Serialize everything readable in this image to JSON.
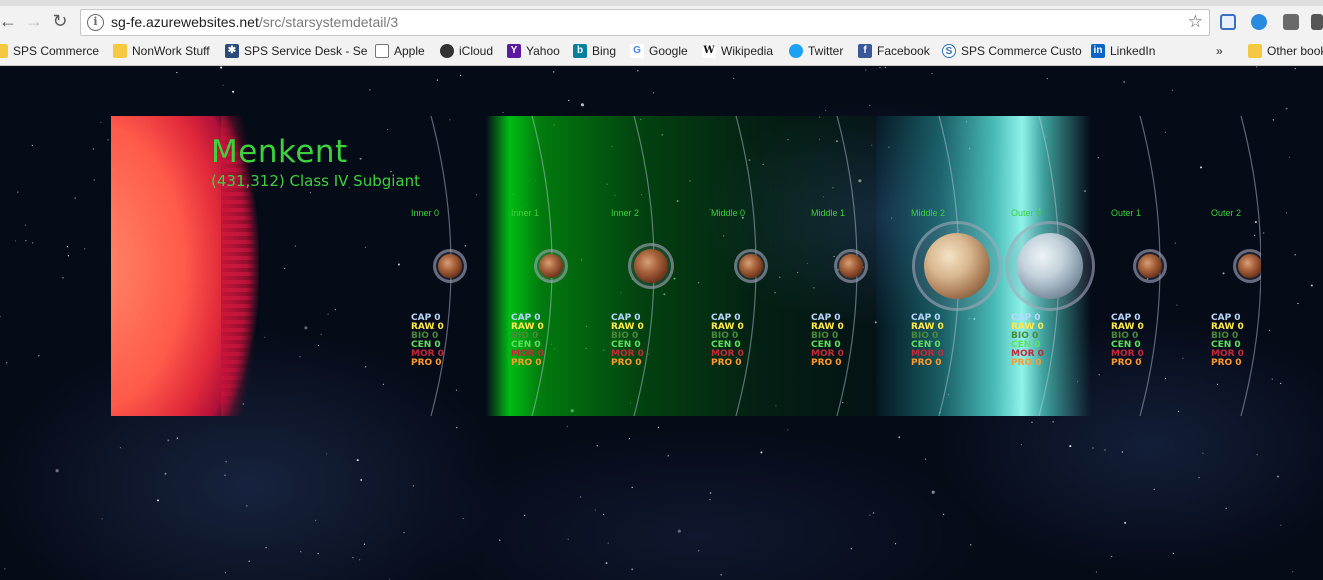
{
  "browser": {
    "url_host": "sg-fe.azurewebsites.net",
    "url_path": "/src/starsystemdetail/3",
    "bookmarks": [
      {
        "label": "SPS Commerce",
        "icon": "folder-icon"
      },
      {
        "label": "NonWork Stuff",
        "icon": "folder-icon"
      },
      {
        "label": "SPS Service Desk - Se",
        "icon": "service-desk-icon"
      },
      {
        "label": "Apple",
        "icon": "page-icon"
      },
      {
        "label": "iCloud",
        "icon": "apple-icon"
      },
      {
        "label": "Yahoo",
        "icon": "yahoo-icon"
      },
      {
        "label": "Bing",
        "icon": "bing-icon"
      },
      {
        "label": "Google",
        "icon": "google-icon"
      },
      {
        "label": "Wikipedia",
        "icon": "wikipedia-icon"
      },
      {
        "label": "Twitter",
        "icon": "twitter-icon"
      },
      {
        "label": "Facebook",
        "icon": "facebook-icon"
      },
      {
        "label": "SPS Commerce Custo",
        "icon": "sps-icon"
      },
      {
        "label": "LinkedIn",
        "icon": "linkedin-icon"
      }
    ],
    "overflow_label": "»",
    "other_bookmarks": "Other book"
  },
  "system": {
    "name": "Menkent",
    "info": "(431,312) Class IV Subgiant"
  },
  "slots": [
    {
      "label": "Inner 0",
      "planet": "rocky",
      "cap": "CAP 0",
      "raw": "RAW 0",
      "bio": "BIO 0",
      "cen": "CEN 0",
      "mor": "MOR 0",
      "pro": "PRO 0"
    },
    {
      "label": "Inner 1",
      "planet": "rocky",
      "cap": "CAP 0",
      "raw": "RAW 0",
      "bio": "BIO 0",
      "cen": "CEN 0",
      "mor": "MOR 0",
      "pro": "PRO 0"
    },
    {
      "label": "Inner 2",
      "planet": "rocky-large",
      "cap": "CAP 0",
      "raw": "RAW 0",
      "bio": "BIO 0",
      "cen": "CEN 0",
      "mor": "MOR 0",
      "pro": "PRO 0"
    },
    {
      "label": "Middle 0",
      "planet": "rocky",
      "cap": "CAP 0",
      "raw": "RAW 0",
      "bio": "BIO 0",
      "cen": "CEN 0",
      "mor": "MOR 0",
      "pro": "PRO 0"
    },
    {
      "label": "Middle 1",
      "planet": "rocky",
      "cap": "CAP 0",
      "raw": "RAW 0",
      "bio": "BIO 0",
      "cen": "CEN 0",
      "mor": "MOR 0",
      "pro": "PRO 0"
    },
    {
      "label": "Middle 2",
      "planet": "sandy-giant",
      "cap": "CAP 0",
      "raw": "RAW 0",
      "bio": "BIO 0",
      "cen": "CEN 0",
      "mor": "MOR 0",
      "pro": "PRO 0"
    },
    {
      "label": "Outer 0",
      "planet": "icy-giant",
      "cap": "CAP 0",
      "raw": "RAW 0",
      "bio": "BIO 0",
      "cen": "CEN 0",
      "mor": "MOR 0",
      "pro": "PRO 0"
    },
    {
      "label": "Outer 1",
      "planet": "rocky",
      "cap": "CAP 0",
      "raw": "RAW 0",
      "bio": "BIO 0",
      "cen": "CEN 0",
      "mor": "MOR 0",
      "pro": "PRO 0"
    },
    {
      "label": "Outer 2",
      "planet": "rocky",
      "cap": "CAP 0",
      "raw": "RAW 0",
      "bio": "BIO 0",
      "cen": "CEN 0",
      "mor": "MOR 0",
      "pro": "PRO 0"
    }
  ],
  "colors": {
    "title_green": "#3ed13e",
    "cap": "#b8d8ff",
    "raw": "#ffe84a",
    "bio": "#4a8a3a",
    "cen": "#5ee05e",
    "mor": "#c8283a",
    "pro": "#ff9a2a"
  }
}
